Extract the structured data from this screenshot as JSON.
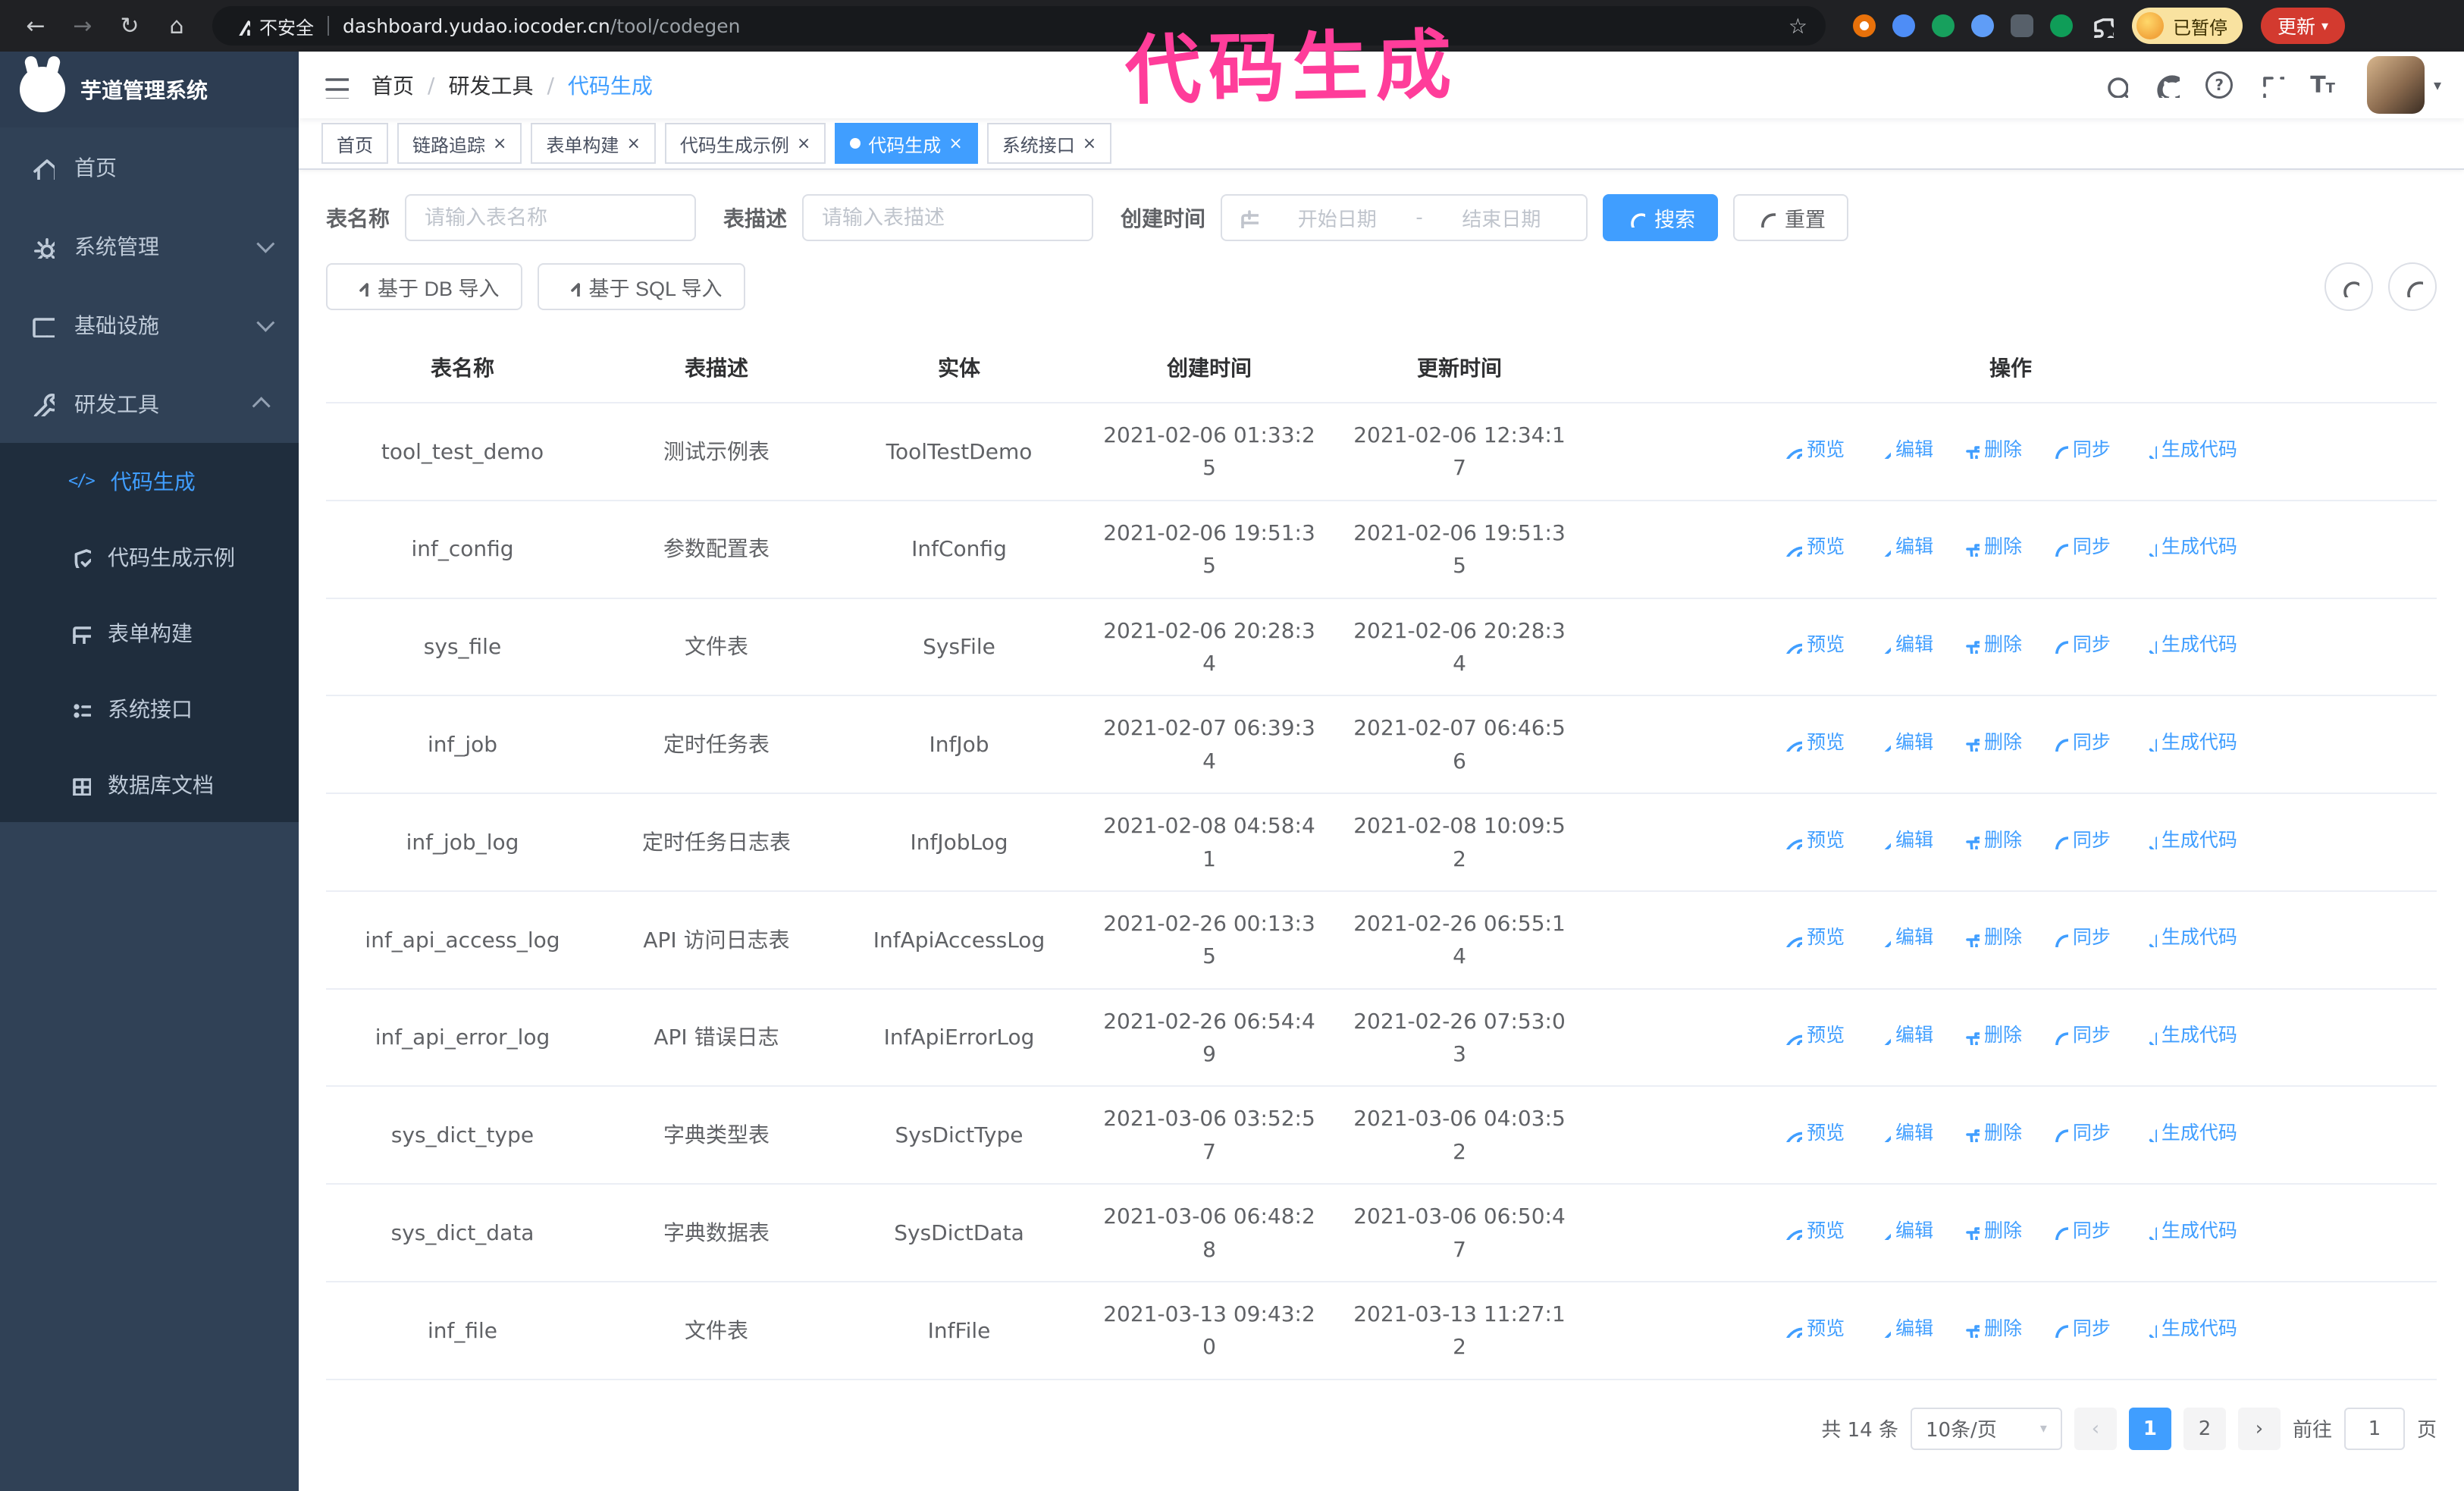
{
  "colors": {
    "accent": "#409EFF",
    "annotation": "#FF3D9A"
  },
  "glyphs": {
    "back": "←",
    "forward": "→",
    "reload": "↻",
    "home": "⌂",
    "star": "☆",
    "caret_down": "▾",
    "slash": "/",
    "close": "×",
    "code": "</>",
    "prev": "‹",
    "next": "›",
    "question": "?",
    "dash": "-",
    "font_size": "T"
  },
  "browser": {
    "security_label": "不安全",
    "url_host": "dashboard.yudao.iocoder.cn",
    "url_path": "/tool/codegen",
    "paused_badge": "已暂停",
    "update_label": "更新"
  },
  "annotation": {
    "text": "代码生成"
  },
  "sidebar": {
    "logo_title": "芋道管理系统",
    "items": [
      {
        "label": "首页"
      },
      {
        "label": "系统管理",
        "expandable": true
      },
      {
        "label": "基础设施",
        "expandable": true
      },
      {
        "label": "研发工具",
        "expandable": true,
        "expanded": true,
        "children": [
          {
            "label": "代码生成",
            "active": true
          },
          {
            "label": "代码生成示例"
          },
          {
            "label": "表单构建"
          },
          {
            "label": "系统接口"
          },
          {
            "label": "数据库文档"
          }
        ]
      }
    ]
  },
  "header": {
    "breadcrumb": [
      "首页",
      "研发工具",
      "代码生成"
    ]
  },
  "tabs": [
    {
      "label": "首页",
      "closable": false,
      "active": false
    },
    {
      "label": "链路追踪",
      "closable": true,
      "active": false
    },
    {
      "label": "表单构建",
      "closable": true,
      "active": false
    },
    {
      "label": "代码生成示例",
      "closable": true,
      "active": false
    },
    {
      "label": "代码生成",
      "closable": true,
      "active": true
    },
    {
      "label": "系统接口",
      "closable": true,
      "active": false
    }
  ],
  "filters": {
    "table_name_label": "表名称",
    "table_name_placeholder": "请输入表名称",
    "table_desc_label": "表描述",
    "table_desc_placeholder": "请输入表描述",
    "create_time_label": "创建时间",
    "date_start": "开始日期",
    "date_end": "结束日期",
    "search": "搜索",
    "reset": "重置"
  },
  "toolbar": {
    "import_db": "基于 DB 导入",
    "import_sql": "基于 SQL 导入"
  },
  "table": {
    "columns": [
      "表名称",
      "表描述",
      "实体",
      "创建时间",
      "更新时间",
      "操作"
    ],
    "row_actions": [
      "预览",
      "编辑",
      "删除",
      "同步",
      "生成代码"
    ],
    "rows": [
      {
        "name": "tool_test_demo",
        "desc": "测试示例表",
        "entity": "ToolTestDemo",
        "created": "2021-02-06 01:33:25",
        "updated": "2021-02-06 12:34:17"
      },
      {
        "name": "inf_config",
        "desc": "参数配置表",
        "entity": "InfConfig",
        "created": "2021-02-06 19:51:35",
        "updated": "2021-02-06 19:51:35"
      },
      {
        "name": "sys_file",
        "desc": "文件表",
        "entity": "SysFile",
        "created": "2021-02-06 20:28:34",
        "updated": "2021-02-06 20:28:34"
      },
      {
        "name": "inf_job",
        "desc": "定时任务表",
        "entity": "InfJob",
        "created": "2021-02-07 06:39:34",
        "updated": "2021-02-07 06:46:56"
      },
      {
        "name": "inf_job_log",
        "desc": "定时任务日志表",
        "entity": "InfJobLog",
        "created": "2021-02-08 04:58:41",
        "updated": "2021-02-08 10:09:52"
      },
      {
        "name": "inf_api_access_log",
        "desc": "API 访问日志表",
        "entity": "InfApiAccessLog",
        "created": "2021-02-26 00:13:35",
        "updated": "2021-02-26 06:55:14"
      },
      {
        "name": "inf_api_error_log",
        "desc": "API 错误日志",
        "entity": "InfApiErrorLog",
        "created": "2021-02-26 06:54:49",
        "updated": "2021-02-26 07:53:03"
      },
      {
        "name": "sys_dict_type",
        "desc": "字典类型表",
        "entity": "SysDictType",
        "created": "2021-03-06 03:52:57",
        "updated": "2021-03-06 04:03:52"
      },
      {
        "name": "sys_dict_data",
        "desc": "字典数据表",
        "entity": "SysDictData",
        "created": "2021-03-06 06:48:28",
        "updated": "2021-03-06 06:50:47"
      },
      {
        "name": "inf_file",
        "desc": "文件表",
        "entity": "InfFile",
        "created": "2021-03-13 09:43:20",
        "updated": "2021-03-13 11:27:12"
      }
    ]
  },
  "pagination": {
    "total": "共 14 条",
    "page_size": "10条/页",
    "pages": [
      "1",
      "2"
    ],
    "active_page": "1",
    "goto_label": "前往",
    "goto_value": "1",
    "goto_suffix": "页"
  }
}
